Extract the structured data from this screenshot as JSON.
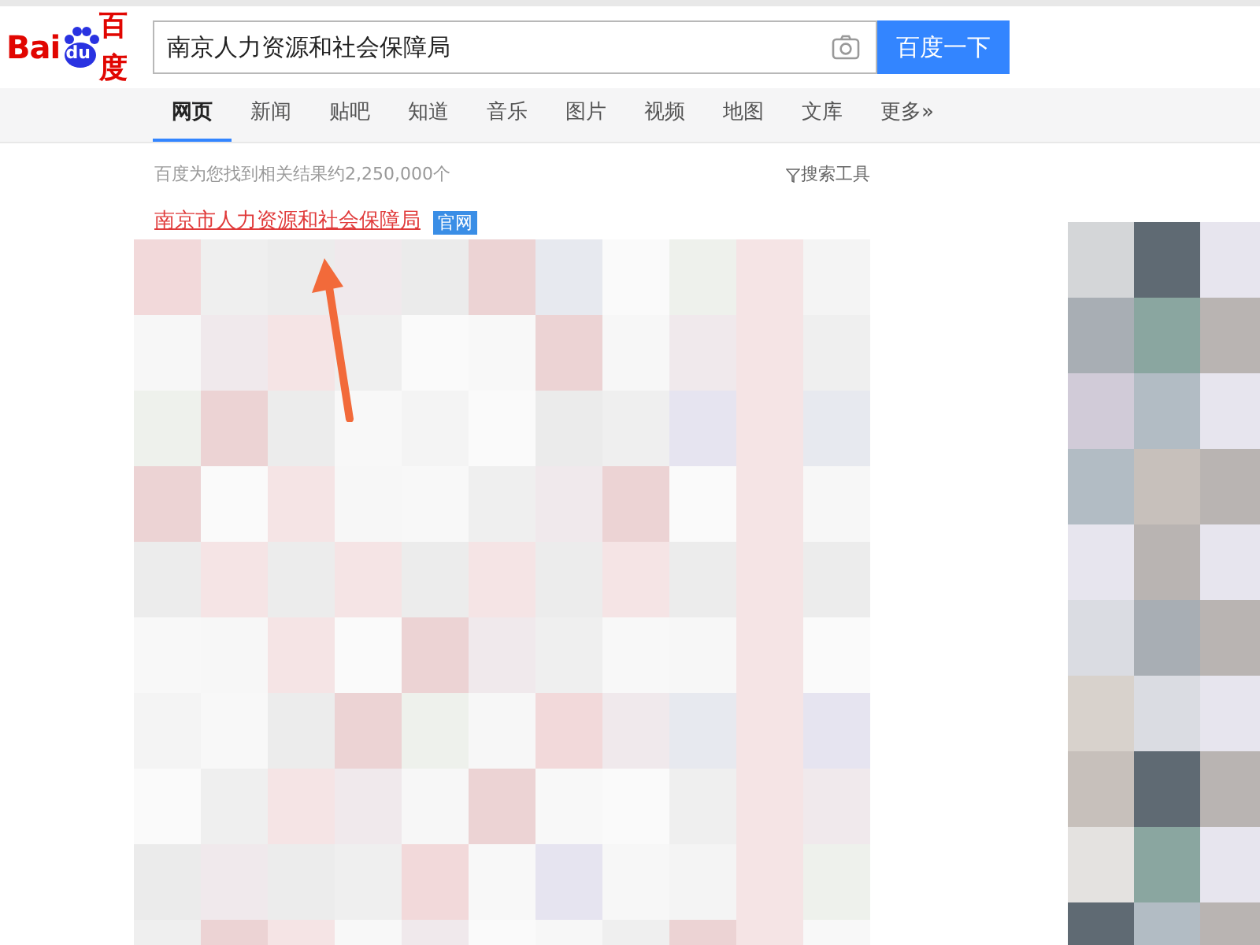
{
  "logo": {
    "left": "Bai",
    "paw": "du",
    "right": "百度"
  },
  "search": {
    "value": "南京人力资源和社会保障局",
    "button": "百度一下"
  },
  "tabs": [
    {
      "label": "网页",
      "selected": true
    },
    {
      "label": "新闻",
      "selected": false
    },
    {
      "label": "贴吧",
      "selected": false
    },
    {
      "label": "知道",
      "selected": false
    },
    {
      "label": "音乐",
      "selected": false
    },
    {
      "label": "图片",
      "selected": false
    },
    {
      "label": "视频",
      "selected": false
    },
    {
      "label": "地图",
      "selected": false
    },
    {
      "label": "文库",
      "selected": false
    },
    {
      "label": "更多»",
      "selected": false
    }
  ],
  "result_count": "百度为您找到相关结果约2,250,000个",
  "search_tools": "搜索工具",
  "first_result": {
    "title": "南京市人力资源和社会保障局",
    "badge": "官网"
  }
}
